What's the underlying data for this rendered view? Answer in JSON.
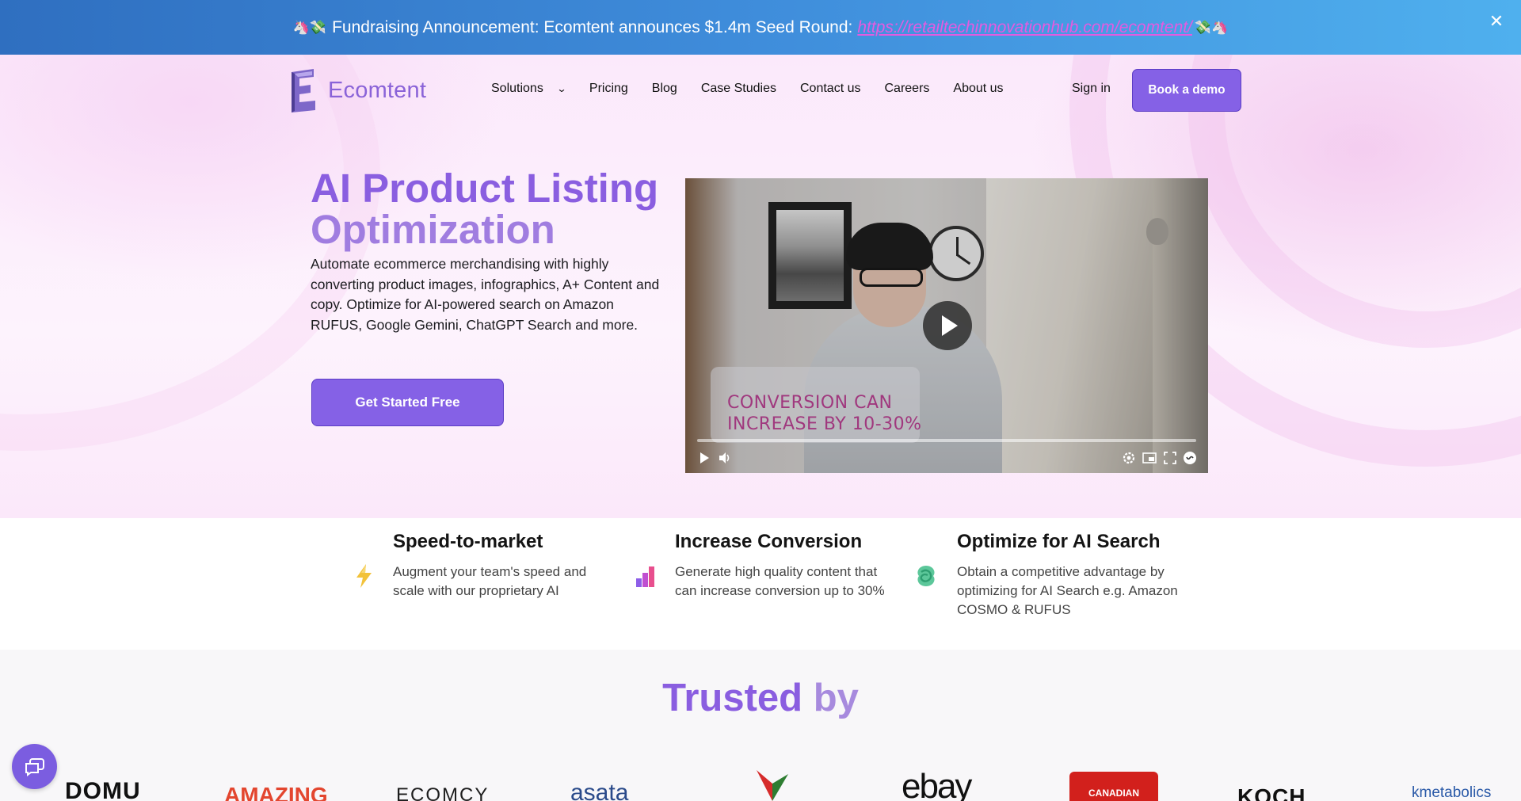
{
  "announcement": {
    "emoji_left": "🦄💸",
    "text": "Fundraising Announcement: Ecomtent announces $1.4m Seed Round:",
    "link": "https://retailtechinnovationhub.com/ecomtent/",
    "emoji_right": "💸🦄",
    "close_label": "✕"
  },
  "nav": {
    "brand": "Ecomtent",
    "links": [
      "Solutions",
      "Pricing",
      "Blog",
      "Case Studies",
      "Contact us",
      "Careers",
      "About us"
    ],
    "signin": "Sign in",
    "demo": "Book a demo"
  },
  "hero": {
    "title_line1": "AI Product Listing",
    "title_line2": "Optimization",
    "description": "Automate ecommerce merchandising with highly converting product images, infographics, A+ Content and copy. Optimize for AI-powered search on Amazon RUFUS, Google Gemini, ChatGPT Search and more.",
    "cta": "Get Started Free"
  },
  "video": {
    "caption_line1": "CONVERSION CAN",
    "caption_line2": "INCREASE BY 10-30%",
    "progress": 0.0
  },
  "features": [
    {
      "title": "Speed-to-market",
      "desc": "Augment your team's speed and scale with our proprietary AI",
      "icon": "lightning-icon"
    },
    {
      "title": "Increase Conversion",
      "desc": "Generate high quality content that can increase conversion up to 30%",
      "icon": "bar-chart-icon"
    },
    {
      "title": "Optimize for AI Search",
      "desc": "Obtain a competitive advantage by optimizing for AI Search e.g. Amazon COSMO & RUFUS",
      "icon": "knot-icon"
    }
  ],
  "trusted": {
    "title_word1": "Trusted",
    "title_word2": "by",
    "logos": [
      "DOMU",
      "AMAZING",
      "ECOMCY",
      "asata",
      "",
      "ebay",
      "CANADIAN",
      "KOCH",
      "kmetabolics"
    ]
  },
  "colors": {
    "accent": "#8561e6",
    "brand_purple": "#8a5ee0",
    "banner_start": "#2f6fc0",
    "banner_end": "#4fb0ee"
  }
}
